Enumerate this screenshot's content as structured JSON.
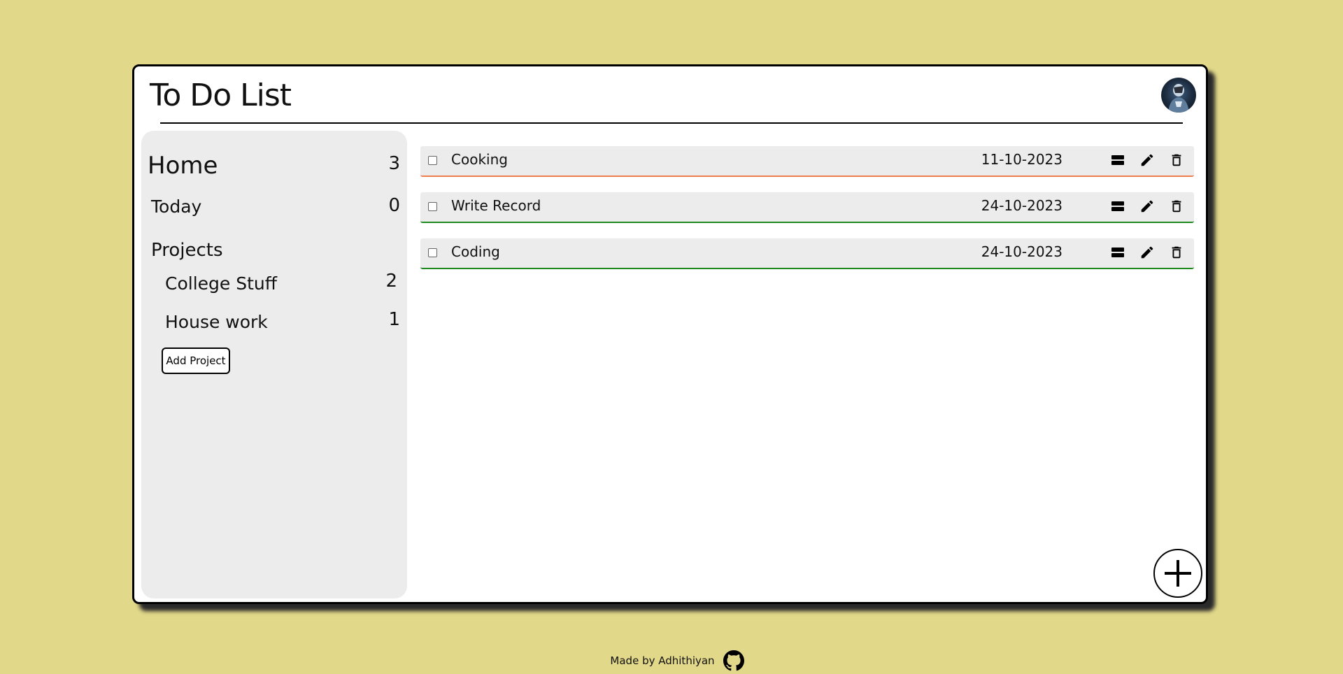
{
  "app": {
    "title": "To Do List"
  },
  "sidebar": {
    "home": {
      "label": "Home",
      "count": "3"
    },
    "today": {
      "label": "Today",
      "count": "0"
    },
    "projects_heading": "Projects",
    "projects": [
      {
        "label": "College Stuff",
        "count": "2"
      },
      {
        "label": "House work",
        "count": "1"
      }
    ],
    "add_project_label": "Add Project"
  },
  "tasks": [
    {
      "title": "Cooking",
      "date": "11-10-2023",
      "priority_color": "#ef7d4e",
      "checked": false
    },
    {
      "title": "Write Record",
      "date": "24-10-2023",
      "priority_color": "#1e8a1e",
      "checked": false
    },
    {
      "title": "Coding",
      "date": "24-10-2023",
      "priority_color": "#1e8a1e",
      "checked": false
    }
  ],
  "icons": {
    "details": "details-icon",
    "edit": "pencil-icon",
    "delete": "trash-icon",
    "add": "plus-icon",
    "footer": "github-icon"
  },
  "footer": {
    "text": "Made by Adhithiyan"
  },
  "colors": {
    "background": "#e2d889",
    "panel": "#ececec"
  }
}
